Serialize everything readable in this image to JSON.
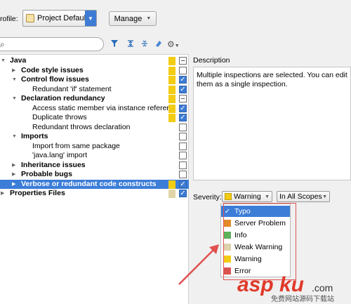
{
  "header": {
    "profile_label": "rofile:",
    "profile_value": "Project Default",
    "manage_label": "Manage"
  },
  "toolbar": {
    "search_placeholder": ""
  },
  "tree": {
    "rows": [
      {
        "label": "Java",
        "bold": true,
        "expanded": true,
        "indent": 0,
        "severity": "#f2cc15",
        "check": "partial"
      },
      {
        "label": "Code style issues",
        "bold": true,
        "expanded": false,
        "indent": 1,
        "severity": "#f2cc15",
        "check": "off"
      },
      {
        "label": "Control flow issues",
        "bold": true,
        "expanded": true,
        "indent": 1,
        "severity": "#f2cc15",
        "check": "on"
      },
      {
        "label": "Redundant 'if' statement",
        "bold": false,
        "indent": 2,
        "severity": "#f2cc15",
        "check": "on"
      },
      {
        "label": "Declaration redundancy",
        "bold": true,
        "expanded": true,
        "indent": 1,
        "severity": "#f2cc15",
        "check": "partial"
      },
      {
        "label": "Access static member via instance referer",
        "bold": false,
        "indent": 2,
        "severity": "#f2cc15",
        "check": "on"
      },
      {
        "label": "Duplicate throws",
        "bold": false,
        "indent": 2,
        "severity": "#f2cc15",
        "check": "on"
      },
      {
        "label": "Redundant throws declaration",
        "bold": false,
        "indent": 2,
        "severity": "",
        "check": "off"
      },
      {
        "label": "Imports",
        "bold": true,
        "expanded": true,
        "indent": 1,
        "severity": "",
        "check": "off"
      },
      {
        "label": "Import from same package",
        "bold": false,
        "indent": 2,
        "severity": "",
        "check": "off"
      },
      {
        "label": "'java.lang' import",
        "bold": false,
        "indent": 2,
        "severity": "",
        "check": "off"
      },
      {
        "label": "Inheritance issues",
        "bold": true,
        "expanded": false,
        "indent": 1,
        "severity": "",
        "check": "off"
      },
      {
        "label": "Probable bugs",
        "bold": true,
        "expanded": false,
        "indent": 1,
        "severity": "",
        "check": "off"
      },
      {
        "label": "Verbose or redundant code constructs",
        "bold": true,
        "expanded": false,
        "indent": 1,
        "severity": "#f2cc15",
        "check": "on",
        "selected": true
      },
      {
        "label": "Properties Files",
        "bold": true,
        "expanded": false,
        "indent": 0,
        "severity": "#e1d5a8",
        "check": "on"
      }
    ]
  },
  "description": {
    "title": "Description",
    "text": "Multiple inspections are selected. You can edit them as a single inspection."
  },
  "severity": {
    "label": "Severity:",
    "value": "Warning",
    "scope": "In All Scopes",
    "options": [
      {
        "label": "Typo",
        "color": "#3c7dd8",
        "selected": true
      },
      {
        "label": "Server Problem",
        "color": "#e38a2a"
      },
      {
        "label": "Info",
        "color": "#5db15a"
      },
      {
        "label": "Weak Warning",
        "color": "#ddd2ac"
      },
      {
        "label": "Warning",
        "color": "#f2cc15"
      },
      {
        "label": "Error",
        "color": "#d9534f"
      }
    ]
  },
  "watermark": {
    "main": "aspku",
    "suffix": ".com",
    "sub": "免费网站源码下载站"
  }
}
